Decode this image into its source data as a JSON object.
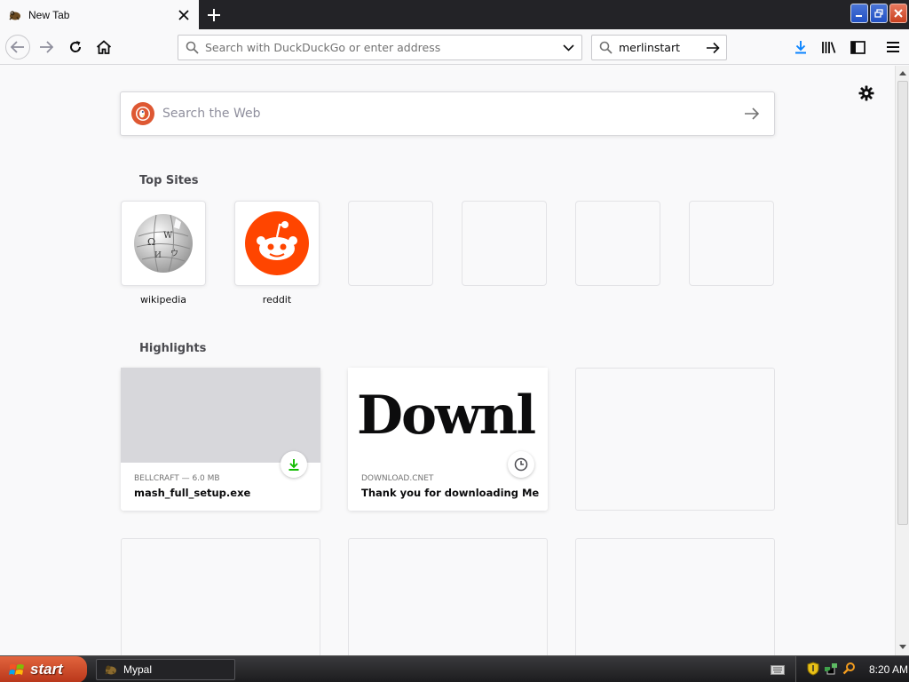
{
  "browser": {
    "tab": {
      "title": "New Tab"
    },
    "urlbar": {
      "placeholder": "Search with DuckDuckGo or enter address"
    },
    "searchbar": {
      "engine_text": "merlinstart"
    }
  },
  "newtab": {
    "websearch": {
      "placeholder": "Search the Web"
    },
    "top_sites": {
      "heading": "Top Sites",
      "sites": [
        {
          "label": "wikipedia",
          "icon": "wikipedia-globe-icon"
        },
        {
          "label": "reddit",
          "icon": "reddit-alien-icon"
        }
      ]
    },
    "highlights": {
      "heading": "Highlights",
      "cards": [
        {
          "context": "BELLCRAFT — 6.0 MB",
          "title": "mash_full_setup.exe",
          "badge": "download-icon"
        },
        {
          "context": "DOWNLOAD.CNET",
          "title": "Thank you for downloading Merl...",
          "thumb_text": "Downl",
          "badge": "clock-icon"
        }
      ]
    }
  },
  "taskbar": {
    "start_label": "start",
    "task_item": "Mypal",
    "clock": "8:20 AM"
  },
  "colors": {
    "download_accent": "#0a84ff",
    "reddit_orange": "#ff4500",
    "ddg_orange": "#de5833",
    "download_green": "#12bc00"
  }
}
